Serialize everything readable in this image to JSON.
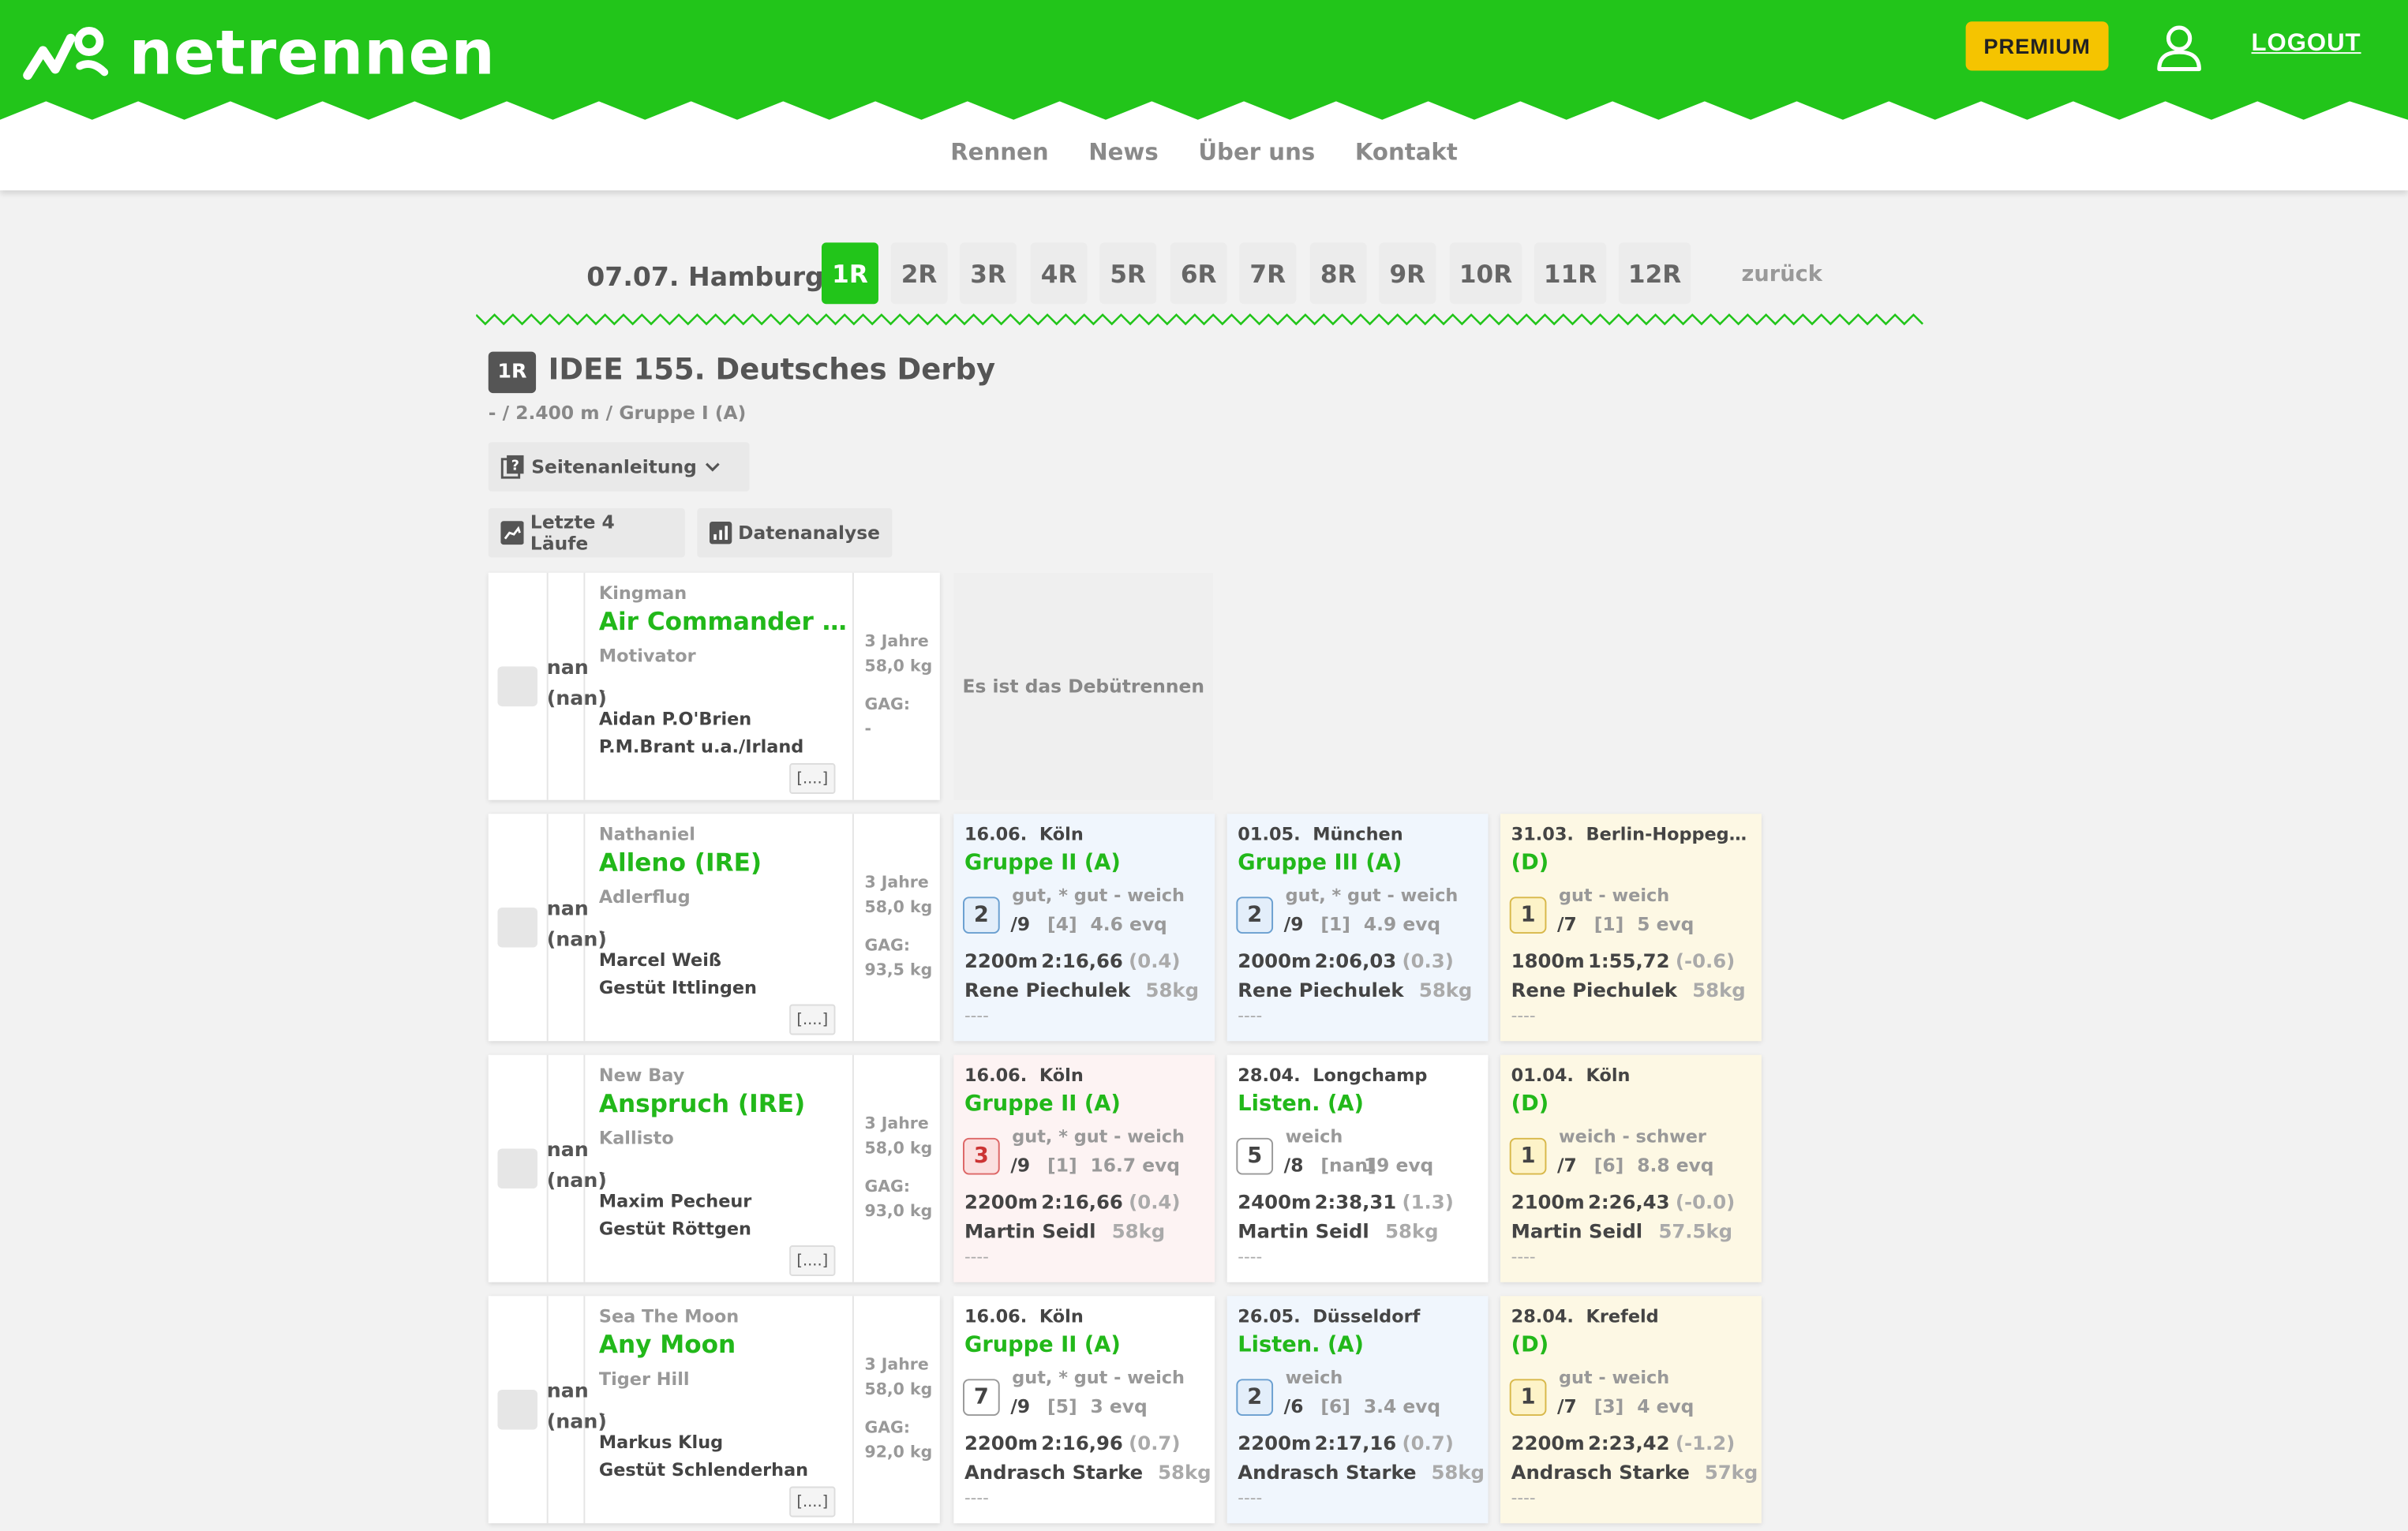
{
  "header": {
    "brand": "netrennen",
    "premium_label": "PREMIUM",
    "logout_label": "LOGOUT",
    "brand_color": "#22c51a"
  },
  "nav": [
    "Rennen",
    "News",
    "Über uns",
    "Kontakt"
  ],
  "race_selector": {
    "venue": "07.07. Hamburg",
    "tabs": [
      "1R",
      "2R",
      "3R",
      "4R",
      "5R",
      "6R",
      "7R",
      "8R",
      "9R",
      "10R",
      "11R",
      "12R"
    ],
    "active": "1R",
    "back_label": "zurück"
  },
  "race": {
    "badge": "1R",
    "title": "IDEE 155. Deutsches Derby",
    "subtitle": "- / 2.400 m / Gruppe I (A)",
    "guide_label": "Seitenanleitung",
    "last4_label": "Letzte 4 Läufe",
    "analysis_label": "Datenanalyse"
  },
  "horses": [
    {
      "nan1": "nan",
      "nan2": "(nan)",
      "sire": "Kingman",
      "name": "Air Commander (IRE)",
      "dam": "Motivator",
      "dash": "-",
      "trainer": "Aidan P.O'Brien",
      "owner": "P.M.Brant u.a./Irland",
      "more": "[....]",
      "age": "3 Jahre",
      "weight": "58,0 kg",
      "gag_label": "GAG:",
      "gag": "-",
      "debut": "Es ist das Debütrennen",
      "runs": []
    },
    {
      "nan1": "nan",
      "nan2": "(nan)",
      "sire": "Nathaniel",
      "name": "Alleno (IRE)",
      "dam": "Adlerflug",
      "dash": "-",
      "trainer": "Marcel Weiß",
      "owner": "Gestüt Ittlingen",
      "more": "[....]",
      "age": "3 Jahre",
      "weight": "58,0 kg",
      "gag_label": "GAG:",
      "gag": "93,5 kg",
      "runs": [
        {
          "date": "16.06.",
          "place_name": "Köln",
          "group": "Gruppe II (A)",
          "track": "gut, * gut - weich",
          "pos": "2",
          "field": "/9",
          "box": "[4]",
          "evq": "4.6 evq",
          "dist": "2200m",
          "time": "2:16,66",
          "diff": "(0.4)",
          "jockey": "Rene Piechulek",
          "wgt": "58kg",
          "line": "----",
          "color": "blue"
        },
        {
          "date": "01.05.",
          "place_name": "München",
          "group": "Gruppe III (A)",
          "track": "gut, * gut - weich",
          "pos": "2",
          "field": "/9",
          "box": "[1]",
          "evq": "4.9 evq",
          "dist": "2000m",
          "time": "2:06,03",
          "diff": "(0.3)",
          "jockey": "Rene Piechulek",
          "wgt": "58kg",
          "line": "----",
          "color": "blue"
        },
        {
          "date": "31.03.",
          "place_name": "Berlin-Hoppegarten",
          "group": "(D)",
          "track": "gut - weich",
          "pos": "1",
          "field": "/7",
          "box": "[1]",
          "evq": "5 evq",
          "dist": "1800m",
          "time": "1:55,72",
          "diff": "(-0.6)",
          "jockey": "Rene Piechulek",
          "wgt": "58kg",
          "line": "----",
          "color": "yellow"
        }
      ]
    },
    {
      "nan1": "nan",
      "nan2": "(nan)",
      "sire": "New Bay",
      "name": "Anspruch (IRE)",
      "dam": "Kallisto",
      "dash": "-",
      "trainer": "Maxim Pecheur",
      "owner": "Gestüt Röttgen",
      "more": "[....]",
      "age": "3 Jahre",
      "weight": "58,0 kg",
      "gag_label": "GAG:",
      "gag": "93,0 kg",
      "runs": [
        {
          "date": "16.06.",
          "place_name": "Köln",
          "group": "Gruppe II (A)",
          "track": "gut, * gut - weich",
          "pos": "3",
          "field": "/9",
          "box": "[1]",
          "evq": "16.7 evq",
          "dist": "2200m",
          "time": "2:16,66",
          "diff": "(0.4)",
          "jockey": "Martin Seidl",
          "wgt": "58kg",
          "line": "----",
          "color": "pink"
        },
        {
          "date": "28.04.",
          "place_name": "Longchamp",
          "group": "Listen. (A)",
          "track": "weich",
          "pos": "5",
          "field": "/8",
          "box": "[nan]",
          "evq": "19 evq",
          "dist": "2400m",
          "time": "2:38,31",
          "diff": "(1.3)",
          "jockey": "Martin Seidl",
          "wgt": "58kg",
          "line": "----",
          "color": "white"
        },
        {
          "date": "01.04.",
          "place_name": "Köln",
          "group": "(D)",
          "track": "weich - schwer",
          "pos": "1",
          "field": "/7",
          "box": "[6]",
          "evq": "8.8 evq",
          "dist": "2100m",
          "time": "2:26,43",
          "diff": "(-0.0)",
          "jockey": "Martin Seidl",
          "wgt": "57.5kg",
          "line": "----",
          "color": "yellow"
        }
      ]
    },
    {
      "nan1": "nan",
      "nan2": "(nan)",
      "sire": "Sea The Moon",
      "name": "Any Moon",
      "dam": "Tiger Hill",
      "dash": "-",
      "trainer": "Markus Klug",
      "owner": "Gestüt Schlenderhan",
      "more": "[....]",
      "age": "3 Jahre",
      "weight": "58,0 kg",
      "gag_label": "GAG:",
      "gag": "92,0 kg",
      "runs": [
        {
          "date": "16.06.",
          "place_name": "Köln",
          "group": "Gruppe II (A)",
          "track": "gut, * gut - weich",
          "pos": "7",
          "field": "/9",
          "box": "[5]",
          "evq": "3 evq",
          "dist": "2200m",
          "time": "2:16,96",
          "diff": "(0.7)",
          "jockey": "Andrasch Starke",
          "wgt": "58kg",
          "line": "----",
          "color": "white"
        },
        {
          "date": "26.05.",
          "place_name": "Düsseldorf",
          "group": "Listen. (A)",
          "track": "weich",
          "pos": "2",
          "field": "/6",
          "box": "[6]",
          "evq": "3.4 evq",
          "dist": "2200m",
          "time": "2:17,16",
          "diff": "(0.7)",
          "jockey": "Andrasch Starke",
          "wgt": "58kg",
          "line": "----",
          "color": "blue"
        },
        {
          "date": "28.04.",
          "place_name": "Krefeld",
          "group": "(D)",
          "track": "gut - weich",
          "pos": "1",
          "field": "/7",
          "box": "[3]",
          "evq": "4 evq",
          "dist": "2200m",
          "time": "2:23,42",
          "diff": "(-1.2)",
          "jockey": "Andrasch Starke",
          "wgt": "57kg",
          "line": "----",
          "color": "yellow"
        }
      ]
    }
  ]
}
